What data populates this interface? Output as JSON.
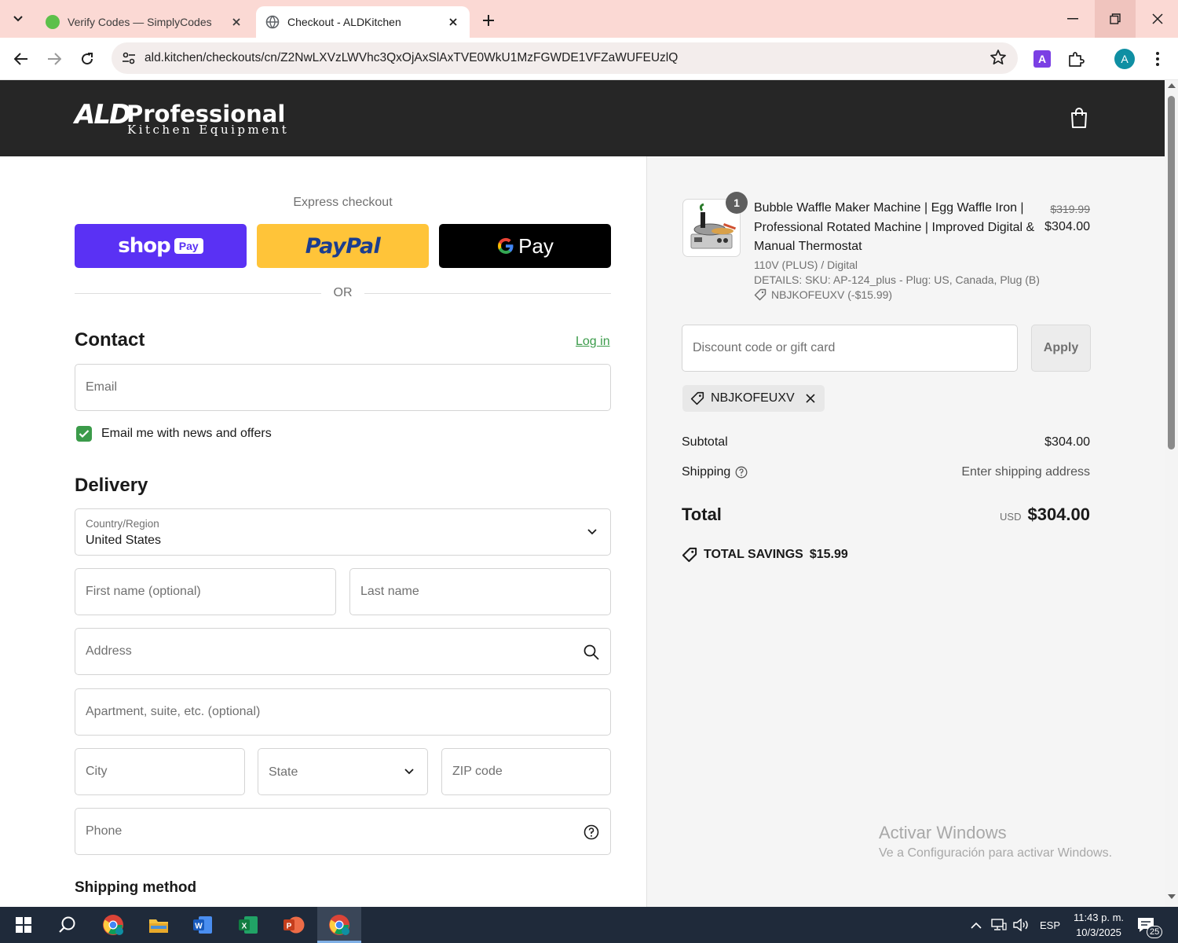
{
  "browser": {
    "tabs": [
      {
        "title": "Verify Codes — SimplyCodes",
        "active": false,
        "icon": "simplycodes-favicon"
      },
      {
        "title": "Checkout - ALDKitchen",
        "active": true,
        "icon": "globe-favicon"
      }
    ],
    "url": "ald.kitchen/checkouts/cn/Z2NwLXVzLWVhc3QxOjAxSlAxTVE0WkU1MzFGWDE1VFZaWUFEUzlQ",
    "profile_initial": "A",
    "extension_label": "A"
  },
  "header": {
    "logo_main": "ALD",
    "logo_pro": "Professional",
    "logo_sub": "Kitchen Equipment"
  },
  "checkout": {
    "express_label": "Express checkout",
    "shoppay_label": "shop",
    "shoppay_badge": "Pay",
    "paypal_label": "PayPal",
    "gpay_label": "Pay",
    "or_label": "OR",
    "contact_title": "Contact",
    "login_label": "Log in",
    "email_placeholder": "Email",
    "newsletter_label": "Email me with news and offers",
    "newsletter_checked": true,
    "delivery_title": "Delivery",
    "country_label": "Country/Region",
    "country_value": "United States",
    "first_name_placeholder": "First name (optional)",
    "last_name_placeholder": "Last name",
    "address_placeholder": "Address",
    "apartment_placeholder": "Apartment, suite, etc. (optional)",
    "city_placeholder": "City",
    "state_placeholder": "State",
    "zip_placeholder": "ZIP code",
    "phone_placeholder": "Phone",
    "shipping_method_title": "Shipping method"
  },
  "summary": {
    "item": {
      "quantity": "1",
      "title": "Bubble Waffle Maker Machine | Egg Waffle Iron | Professional Rotated Machine | Improved Digital & Manual Thermostat",
      "variant": "110V (PLUS) / Digital",
      "details": "DETAILS: SKU: AP-124_plus - Plug: US, Canada, Plug (B)",
      "discount": "NBJKOFEUXV (-$15.99)",
      "price_original": "$319.99",
      "price_final": "$304.00"
    },
    "discount_placeholder": "Discount code or gift card",
    "apply_label": "Apply",
    "applied_code": "NBJKOFEUXV",
    "subtotal_label": "Subtotal",
    "subtotal_value": "$304.00",
    "shipping_label": "Shipping",
    "shipping_value": "Enter shipping address",
    "total_label": "Total",
    "total_currency": "USD",
    "total_value": "$304.00",
    "savings_label": "TOTAL SAVINGS",
    "savings_value": "$15.99"
  },
  "watermark": {
    "line1": "Activar Windows",
    "line2": "Ve a Configuración para activar Windows."
  },
  "taskbar": {
    "language": "ESP",
    "time": "11:43 p. m.",
    "date": "10/3/2025",
    "notifications": "25"
  },
  "colors": {
    "accent_green": "#3b9b4a",
    "shoppay_purple": "#5a31f4",
    "paypal_yellow": "#ffc439",
    "header_dark": "#262626",
    "tabstrip_pink": "#fbd9d4"
  }
}
